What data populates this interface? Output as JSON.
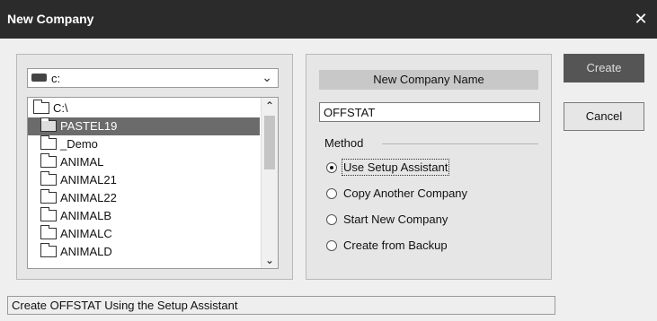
{
  "window": {
    "title": "New Company",
    "close_glyph": "✕"
  },
  "drive": {
    "icon": "drive-icon",
    "value": "c:",
    "chevron": "⌄"
  },
  "folders": {
    "items": [
      {
        "label": "C:\\",
        "icon": "open-folder-icon"
      },
      {
        "label": "PASTEL19",
        "icon": "open-folder-icon",
        "selected": true
      },
      {
        "label": "_Demo",
        "icon": "folder-icon"
      },
      {
        "label": "ANIMAL",
        "icon": "folder-icon"
      },
      {
        "label": "ANIMAL21",
        "icon": "folder-icon"
      },
      {
        "label": "ANIMAL22",
        "icon": "folder-icon"
      },
      {
        "label": "ANIMALB",
        "icon": "folder-icon"
      },
      {
        "label": "ANIMALC",
        "icon": "folder-icon"
      },
      {
        "label": "ANIMALD",
        "icon": "folder-icon"
      }
    ],
    "scroll_up": "⌃",
    "scroll_down": "⌄"
  },
  "company": {
    "name_label": "New Company Name",
    "name_value": "OFFSTAT"
  },
  "method": {
    "legend": "Method",
    "options": [
      {
        "label": "Use Setup Assistant",
        "checked": true
      },
      {
        "label": "Copy Another Company",
        "checked": false
      },
      {
        "label": "Start New Company",
        "checked": false
      },
      {
        "label": "Create from Backup",
        "checked": false
      }
    ]
  },
  "buttons": {
    "create": "Create",
    "cancel": "Cancel"
  },
  "status": {
    "text": "Create OFFSTAT Using the Setup Assistant"
  },
  "colors": {
    "titlebar": "#2b2b2b",
    "selected_row": "#6b6b6b",
    "panel": "#e6e6e6"
  }
}
